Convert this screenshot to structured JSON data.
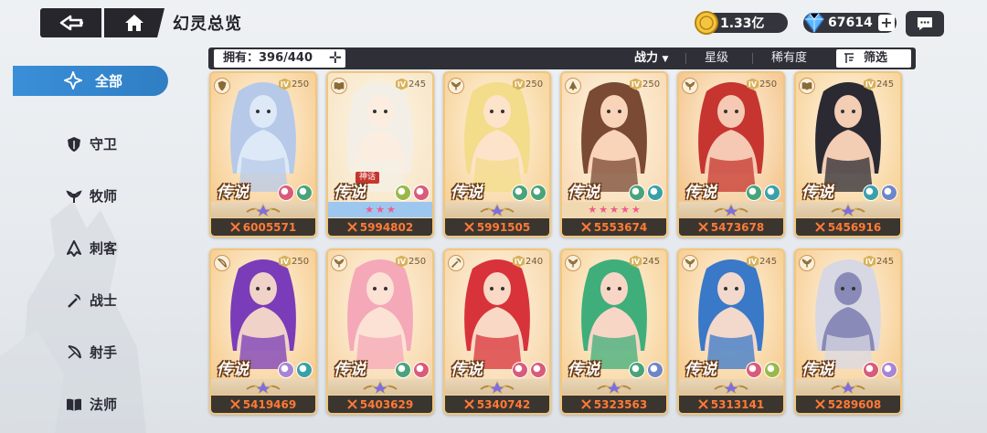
{
  "header": {
    "title": "幻灵总览",
    "gold": "1.33亿",
    "gems": "67614"
  },
  "sidebar": {
    "items": [
      {
        "label": "全部",
        "icon": "star-burst-icon",
        "active": true
      },
      {
        "label": "守卫",
        "icon": "shield-icon"
      },
      {
        "label": "牧师",
        "icon": "leaf-wings-icon"
      },
      {
        "label": "刺客",
        "icon": "assassin-hood-icon"
      },
      {
        "label": "战士",
        "icon": "axe-icon"
      },
      {
        "label": "射手",
        "icon": "bow-icon"
      },
      {
        "label": "法师",
        "icon": "book-icon"
      }
    ]
  },
  "filterbar": {
    "owned_label": "拥有：396/440",
    "sort_power": "战力",
    "sort_star": "星级",
    "sort_rarity": "稀有度",
    "filter": "筛选"
  },
  "cards": [
    {
      "rank": "IV",
      "level": "250",
      "rarity": "传说",
      "power": "6005571",
      "cls": "shield-icon",
      "elements": [
        "#d95b7a",
        "#4aa37a"
      ],
      "tier": "gold",
      "skin": "#dde9f7",
      "hair": "#b7c9e8",
      "bg": "#f6c98a"
    },
    {
      "rank": "IV",
      "level": "245",
      "rarity": "传说",
      "power": "5994802",
      "cls": "book-icon",
      "elements": [
        "#9ab84a",
        "#d95b7a"
      ],
      "tier": "blue",
      "tag": "神话",
      "stars": 3,
      "skin": "#fbeee0",
      "hair": "#f3efe6",
      "bg": "#f5e3c4"
    },
    {
      "rank": "IV",
      "level": "250",
      "rarity": "传说",
      "power": "5991505",
      "cls": "leaf-wings-icon",
      "elements": [
        "#4aa37a",
        "#4aa37a"
      ],
      "tier": "gold",
      "skin": "#fde3c9",
      "hair": "#f3dc8a",
      "bg": "#f6cf92"
    },
    {
      "rank": "IV",
      "level": "250",
      "rarity": "传说",
      "power": "5553674",
      "cls": "assassin-hood-icon",
      "elements": [
        "#4aa37a",
        "#3aa0a8"
      ],
      "tier": "stars",
      "stars": 5,
      "skin": "#fad4b8",
      "hair": "#7a4a34",
      "bg": "#f8d7b0"
    },
    {
      "rank": "IV",
      "level": "250",
      "rarity": "传说",
      "power": "5473678",
      "cls": "leaf-wings-icon",
      "elements": [
        "#4aa37a",
        "#3aa0a8"
      ],
      "tier": "gold",
      "skin": "#f5c9b3",
      "hair": "#c6352f",
      "bg": "#f3c085"
    },
    {
      "rank": "IV",
      "level": "245",
      "rarity": "传说",
      "power": "5456916",
      "cls": "book-icon",
      "elements": [
        "#3aa0a8",
        "#6e86c8"
      ],
      "tier": "gold",
      "skin": "#f3cdb4",
      "hair": "#2b2a33",
      "bg": "#f6cf92"
    },
    {
      "rank": "IV",
      "level": "250",
      "rarity": "传说",
      "power": "5419469",
      "cls": "bow-icon",
      "elements": [
        "#a884d4",
        "#3aa0a8"
      ],
      "tier": "gold",
      "skin": "#f0d2c8",
      "hair": "#7a3cb8",
      "bg": "#f6c98a"
    },
    {
      "rank": "IV",
      "level": "250",
      "rarity": "传说",
      "power": "5403629",
      "cls": "leaf-wings-icon",
      "elements": [
        "#4aa37a",
        "#d95b7a"
      ],
      "tier": "gold",
      "skin": "#fbe2d4",
      "hair": "#f5a8b8",
      "bg": "#f6d3a4"
    },
    {
      "rank": "IV",
      "level": "240",
      "rarity": "传说",
      "power": "5340742",
      "cls": "axe-icon",
      "elements": [
        "#d95b7a",
        "#d95b7a"
      ],
      "tier": "gold",
      "skin": "#fad8c6",
      "hair": "#d8333a",
      "bg": "#f6d3a4"
    },
    {
      "rank": "IV",
      "level": "245",
      "rarity": "传说",
      "power": "5323563",
      "cls": "leaf-wings-icon",
      "elements": [
        "#4aa37a",
        "#6e86c8"
      ],
      "tier": "gold",
      "skin": "#f8d6c6",
      "hair": "#3fae7a",
      "bg": "#f6cf92"
    },
    {
      "rank": "IV",
      "level": "245",
      "rarity": "传说",
      "power": "5313141",
      "cls": "leaf-wings-icon",
      "elements": [
        "#d95b7a",
        "#9ab84a"
      ],
      "tier": "gold",
      "skin": "#f3d8cc",
      "hair": "#3a78c8",
      "bg": "#f6c98a"
    },
    {
      "rank": "IV",
      "level": "245",
      "rarity": "传说",
      "power": "5289608",
      "cls": "leaf-wings-icon",
      "elements": [
        "#d95b7a",
        "#a884d4"
      ],
      "tier": "gold",
      "skin": "#8a8ab8",
      "hair": "#d8d8e4",
      "bg": "#f6c98a"
    }
  ]
}
